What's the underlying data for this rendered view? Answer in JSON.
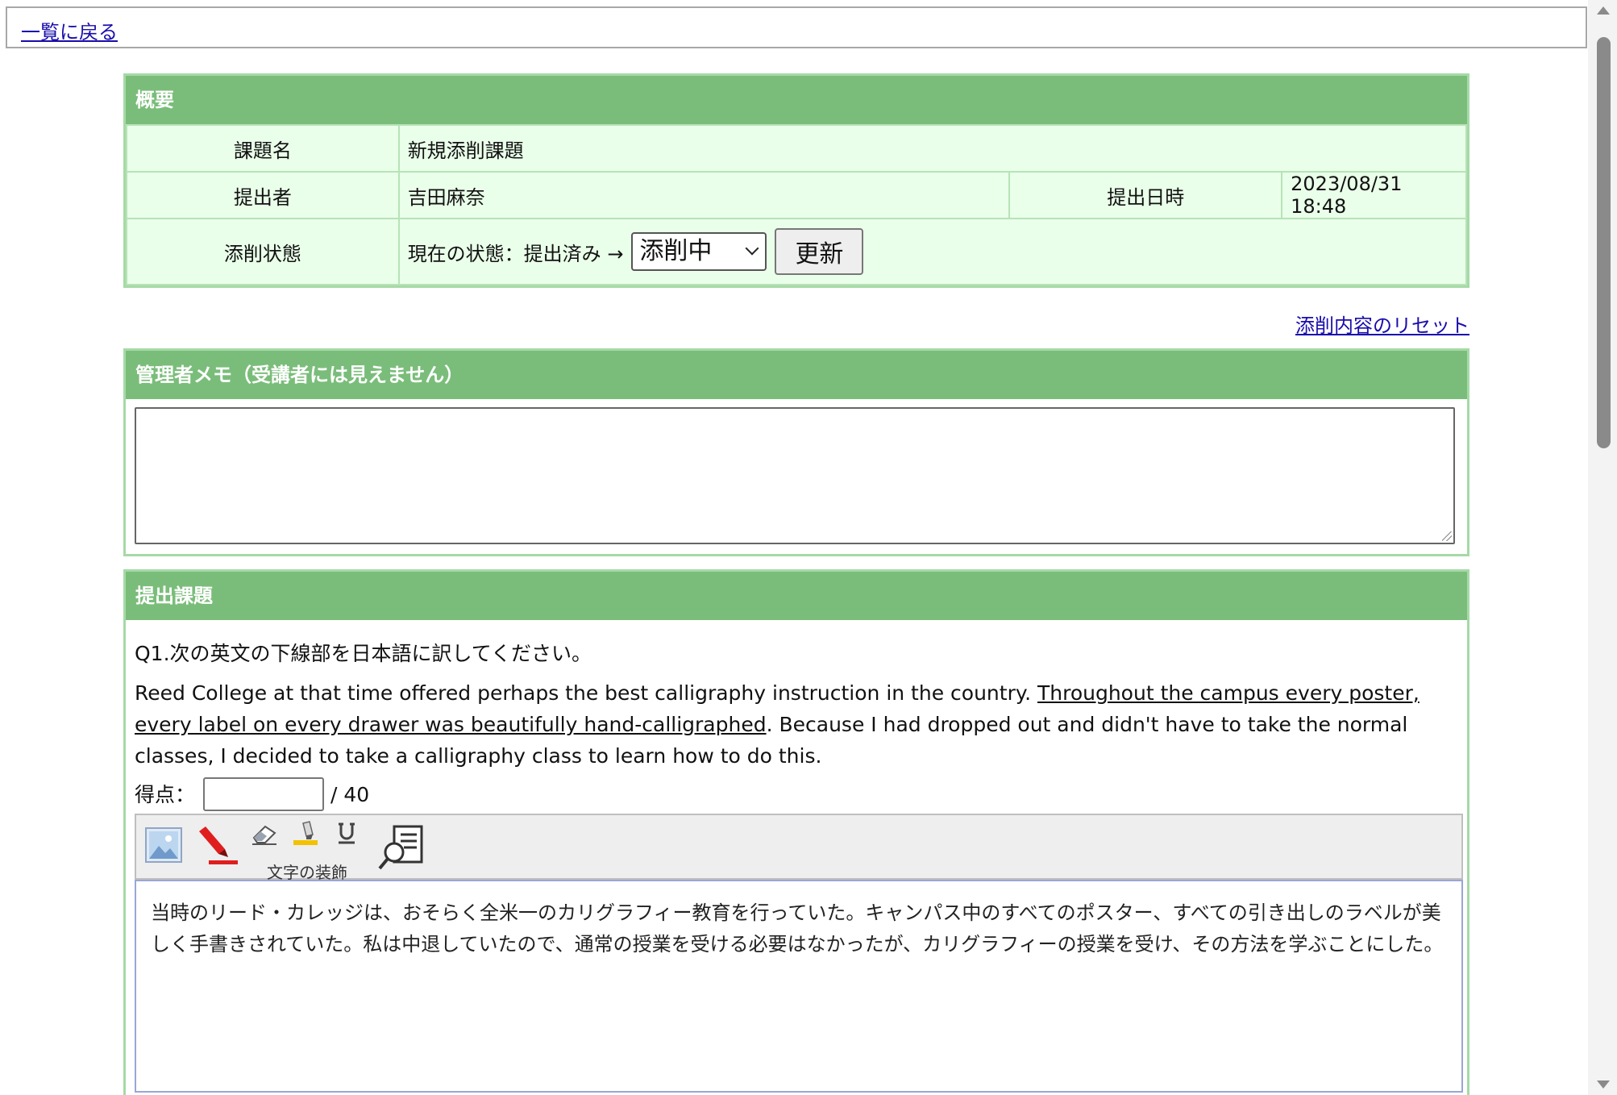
{
  "topbar": {
    "back_link": "一覧に戻る"
  },
  "overview": {
    "title": "概要",
    "assignment_label": "課題名",
    "assignment_value": "新規添削課題",
    "submitter_label": "提出者",
    "submitter_value": "吉田麻奈",
    "submitted_at_label": "提出日時",
    "submitted_at_value": "2023/08/31 18:48",
    "status_label": "添削状態",
    "status_current": "現在の状態：提出済み →",
    "status_selected": "添削中",
    "update_button": "更新"
  },
  "reset_link": "添削内容のリセット",
  "memo": {
    "title": "管理者メモ（受講者には見えません）",
    "value": ""
  },
  "task": {
    "title": "提出課題",
    "question_title": "Q1.次の英文の下線部を日本語に訳してください。",
    "text_before": "Reed College at that time offered perhaps the best calligraphy instruction in the country. ",
    "text_underlined": "Throughout the campus every poster, every label on every drawer was beautifully hand-calligraphed",
    "text_after": ". Because I had dropped out and didn't have to take the normal classes, I decided to take a calligraphy class to learn how to do this.",
    "score_label": "得点：",
    "score_value": "",
    "score_max": "/ 40",
    "toolbar": {
      "icons": [
        "image-icon",
        "red-pen-icon",
        "eraser-icon",
        "highlighter-icon",
        "underline-icon",
        "magnifier-document-icon"
      ],
      "decoration_caption": "文字の装飾"
    },
    "answer": "当時のリード・カレッジは、おそらく全米一のカリグラフィー教育を行っていた。キャンパス中のすべてのポスター、すべての引き出しのラベルが美しく手書きされていた。私は中退していたので、通常の授業を受ける必要はなかったが、カリグラフィーの授業を受け、その方法を学ぶことにした。"
  }
}
